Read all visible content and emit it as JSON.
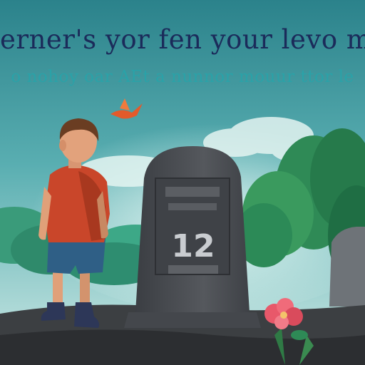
{
  "scene": {
    "caption_line_1": "erner's yor fen your levo mer",
    "caption_line_2": "o nohoy oar AEt a nunnor mouur ttor le",
    "headstone_number": "12"
  },
  "colors": {
    "sky_top": "#2e8a93",
    "sky_bottom": "#bfe7e6",
    "shirt": "#c9462a",
    "shorts": "#2f5f86",
    "headstone": "#4a4d52",
    "foliage": "#2e8a56",
    "flower": "#e8586a",
    "bird": "#e35a2b"
  }
}
